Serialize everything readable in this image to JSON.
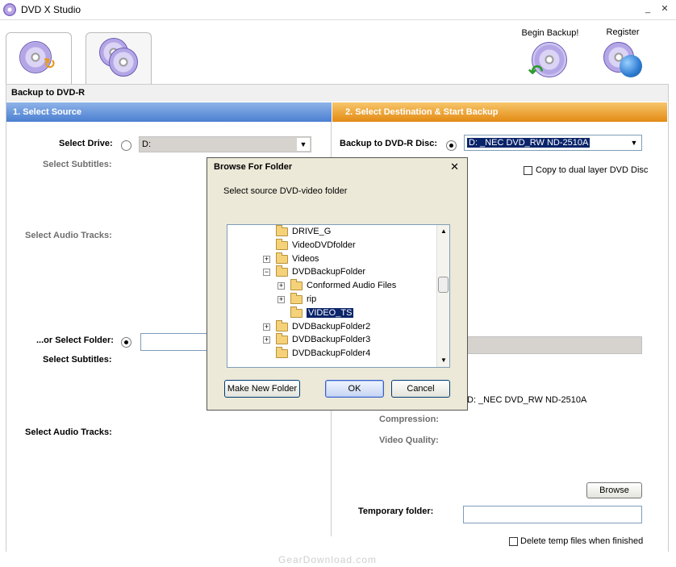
{
  "window": {
    "title": "DVD X Studio"
  },
  "toolbar": {
    "begin_backup": "Begin Backup!",
    "register": "Register"
  },
  "header": {
    "title": "Backup to DVD-R"
  },
  "source": {
    "section_title": "1. Select Source",
    "select_drive_label": "Select Drive:",
    "drive_value": "D:",
    "select_subtitles_label": "Select Subtitles:",
    "select_audio_label": "Select Audio Tracks:",
    "or_select_folder_label": "...or Select Folder:",
    "select_subtitles_label_2": "Select Subtitles:",
    "select_audio_label_2": "Select Audio Tracks:"
  },
  "destination": {
    "section_title": "2. Select Destination & Start Backup",
    "backup_to_label": "Backup to DVD-R Disc:",
    "disc_value": "D:  _NEC     DVD_RW ND-2510A",
    "dual_layer_label": "Copy to dual layer DVD Disc",
    "disc_value_2": "D:  _NEC     DVD_RW ND-2510A",
    "compression_label": "Compression:",
    "video_quality_label": "Video Quality:",
    "browse_label": "Browse",
    "temp_folder_label": "Temporary folder:",
    "delete_temp_label": "Delete temp files when finished"
  },
  "dialog": {
    "title": "Browse For Folder",
    "prompt": "Select source DVD-video folder",
    "tree": [
      {
        "label": "DRIVE_G",
        "level": 2,
        "expander": "",
        "selected": false
      },
      {
        "label": "VideoDVDfolder",
        "level": 2,
        "expander": "",
        "selected": false
      },
      {
        "label": "Videos",
        "level": 2,
        "expander": "+",
        "selected": false
      },
      {
        "label": "DVDBackupFolder",
        "level": 2,
        "expander": "−",
        "selected": false
      },
      {
        "label": "Conformed Audio Files",
        "level": 3,
        "expander": "+",
        "selected": false
      },
      {
        "label": "rip",
        "level": 3,
        "expander": "+",
        "selected": false
      },
      {
        "label": "VIDEO_TS",
        "level": 3,
        "expander": "",
        "selected": true
      },
      {
        "label": "DVDBackupFolder2",
        "level": 2,
        "expander": "+",
        "selected": false
      },
      {
        "label": "DVDBackupFolder3",
        "level": 2,
        "expander": "+",
        "selected": false
      },
      {
        "label": "DVDBackupFolder4",
        "level": 2,
        "expander": "",
        "selected": false
      }
    ],
    "make_new_folder": "Make New Folder",
    "ok": "OK",
    "cancel": "Cancel"
  },
  "watermark": "GearDownload.com",
  "colors": {
    "source_header": "#4a7fd1",
    "destination_header": "#e38a14",
    "selection": "#0a246a"
  }
}
